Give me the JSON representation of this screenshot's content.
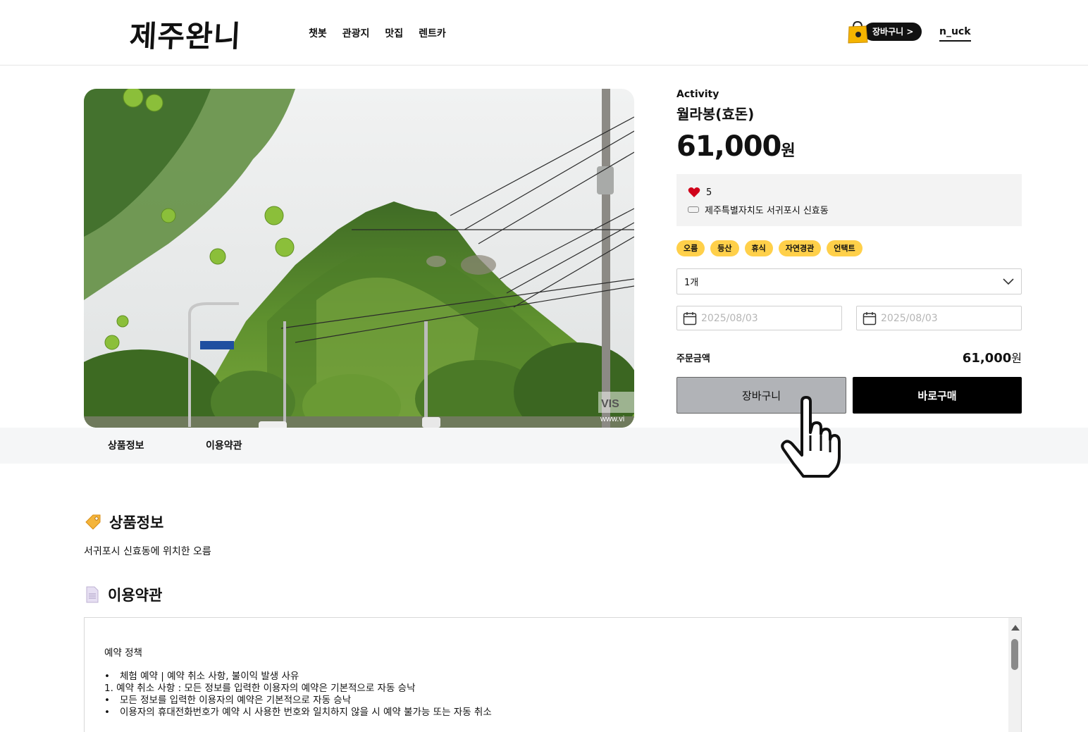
{
  "header": {
    "logo": "제주완니",
    "nav": [
      "챗봇",
      "관광지",
      "맛집",
      "렌트카"
    ],
    "cart_label": "장바구니 >",
    "username": "n_uck"
  },
  "product": {
    "category": "Activity",
    "title": "월라봉(효돈)",
    "price_number": "61,000",
    "price_unit": "원",
    "likes": "5",
    "location": "제주특별자치도 서귀포시 신효동",
    "tags": [
      "오름",
      "등산",
      "휴식",
      "자연경관",
      "언택트"
    ],
    "quantity": "1개",
    "start_date_placeholder": "2025/08/03",
    "end_date_placeholder": "2025/08/03",
    "total_label": "주문금액",
    "total_number": "61,000",
    "total_unit": "원",
    "cart_button": "장바구니",
    "buy_button": "바로구매",
    "image_watermark": "VIS",
    "image_watermark_url": "www.vi"
  },
  "tabs": [
    "상품정보",
    "이용약관"
  ],
  "info_section": {
    "title": "상품정보",
    "description": "서귀포시 신효동에 위치한 오름"
  },
  "terms_section": {
    "title": "이용약관",
    "heading": "예약 정책",
    "lines": [
      {
        "bullet": true,
        "text": "체험 예약 | 예약 취소 사항, 불이익 발생 사유"
      },
      {
        "bullet": false,
        "text": "1. 예약 취소 사항 : 모든 정보를 입력한 이용자의 예약은 기본적으로 자동 승낙"
      },
      {
        "bullet": true,
        "text": "모든 정보를 입력한 이용자의 예약은 기본적으로 자동 승낙"
      },
      {
        "bullet": true,
        "text": "이용자의 휴대전화번호가 예약 시 사용한 번호와 일치하지 않을 시 예약 불가능 또는 자동 취소"
      }
    ]
  },
  "colors": {
    "tag_bg": "#ffd04a",
    "buy_bg": "#000000",
    "cart_btn_bg": "#b1b3b7",
    "tabbar_bg": "#f5f6f7",
    "heart": "#d0021b"
  }
}
